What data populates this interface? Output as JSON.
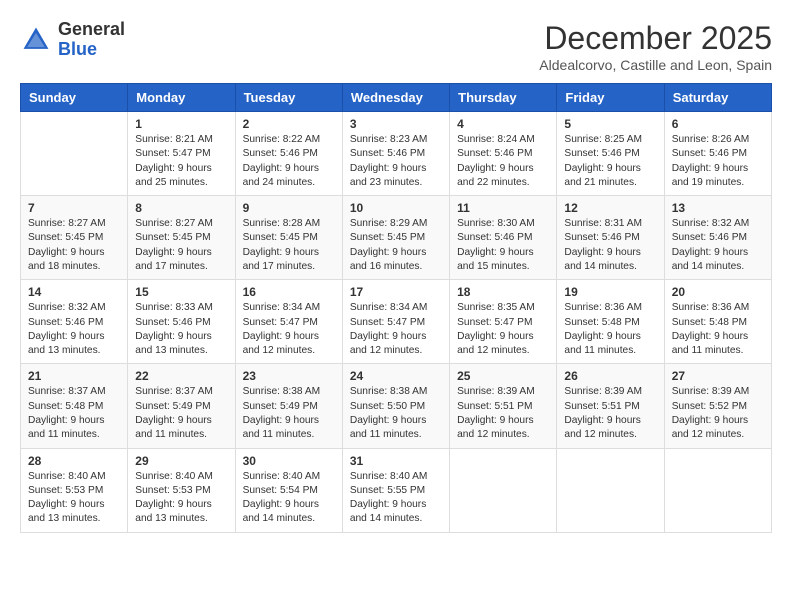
{
  "header": {
    "logo_general": "General",
    "logo_blue": "Blue",
    "month_title": "December 2025",
    "subtitle": "Aldealcorvo, Castille and Leon, Spain"
  },
  "calendar": {
    "days_of_week": [
      "Sunday",
      "Monday",
      "Tuesday",
      "Wednesday",
      "Thursday",
      "Friday",
      "Saturday"
    ],
    "weeks": [
      [
        {
          "day": "",
          "content": ""
        },
        {
          "day": "1",
          "content": "Sunrise: 8:21 AM\nSunset: 5:47 PM\nDaylight: 9 hours\nand 25 minutes."
        },
        {
          "day": "2",
          "content": "Sunrise: 8:22 AM\nSunset: 5:46 PM\nDaylight: 9 hours\nand 24 minutes."
        },
        {
          "day": "3",
          "content": "Sunrise: 8:23 AM\nSunset: 5:46 PM\nDaylight: 9 hours\nand 23 minutes."
        },
        {
          "day": "4",
          "content": "Sunrise: 8:24 AM\nSunset: 5:46 PM\nDaylight: 9 hours\nand 22 minutes."
        },
        {
          "day": "5",
          "content": "Sunrise: 8:25 AM\nSunset: 5:46 PM\nDaylight: 9 hours\nand 21 minutes."
        },
        {
          "day": "6",
          "content": "Sunrise: 8:26 AM\nSunset: 5:46 PM\nDaylight: 9 hours\nand 19 minutes."
        }
      ],
      [
        {
          "day": "7",
          "content": "Sunrise: 8:27 AM\nSunset: 5:45 PM\nDaylight: 9 hours\nand 18 minutes."
        },
        {
          "day": "8",
          "content": "Sunrise: 8:27 AM\nSunset: 5:45 PM\nDaylight: 9 hours\nand 17 minutes."
        },
        {
          "day": "9",
          "content": "Sunrise: 8:28 AM\nSunset: 5:45 PM\nDaylight: 9 hours\nand 17 minutes."
        },
        {
          "day": "10",
          "content": "Sunrise: 8:29 AM\nSunset: 5:45 PM\nDaylight: 9 hours\nand 16 minutes."
        },
        {
          "day": "11",
          "content": "Sunrise: 8:30 AM\nSunset: 5:46 PM\nDaylight: 9 hours\nand 15 minutes."
        },
        {
          "day": "12",
          "content": "Sunrise: 8:31 AM\nSunset: 5:46 PM\nDaylight: 9 hours\nand 14 minutes."
        },
        {
          "day": "13",
          "content": "Sunrise: 8:32 AM\nSunset: 5:46 PM\nDaylight: 9 hours\nand 14 minutes."
        }
      ],
      [
        {
          "day": "14",
          "content": "Sunrise: 8:32 AM\nSunset: 5:46 PM\nDaylight: 9 hours\nand 13 minutes."
        },
        {
          "day": "15",
          "content": "Sunrise: 8:33 AM\nSunset: 5:46 PM\nDaylight: 9 hours\nand 13 minutes."
        },
        {
          "day": "16",
          "content": "Sunrise: 8:34 AM\nSunset: 5:47 PM\nDaylight: 9 hours\nand 12 minutes."
        },
        {
          "day": "17",
          "content": "Sunrise: 8:34 AM\nSunset: 5:47 PM\nDaylight: 9 hours\nand 12 minutes."
        },
        {
          "day": "18",
          "content": "Sunrise: 8:35 AM\nSunset: 5:47 PM\nDaylight: 9 hours\nand 12 minutes."
        },
        {
          "day": "19",
          "content": "Sunrise: 8:36 AM\nSunset: 5:48 PM\nDaylight: 9 hours\nand 11 minutes."
        },
        {
          "day": "20",
          "content": "Sunrise: 8:36 AM\nSunset: 5:48 PM\nDaylight: 9 hours\nand 11 minutes."
        }
      ],
      [
        {
          "day": "21",
          "content": "Sunrise: 8:37 AM\nSunset: 5:48 PM\nDaylight: 9 hours\nand 11 minutes."
        },
        {
          "day": "22",
          "content": "Sunrise: 8:37 AM\nSunset: 5:49 PM\nDaylight: 9 hours\nand 11 minutes."
        },
        {
          "day": "23",
          "content": "Sunrise: 8:38 AM\nSunset: 5:49 PM\nDaylight: 9 hours\nand 11 minutes."
        },
        {
          "day": "24",
          "content": "Sunrise: 8:38 AM\nSunset: 5:50 PM\nDaylight: 9 hours\nand 11 minutes."
        },
        {
          "day": "25",
          "content": "Sunrise: 8:39 AM\nSunset: 5:51 PM\nDaylight: 9 hours\nand 12 minutes."
        },
        {
          "day": "26",
          "content": "Sunrise: 8:39 AM\nSunset: 5:51 PM\nDaylight: 9 hours\nand 12 minutes."
        },
        {
          "day": "27",
          "content": "Sunrise: 8:39 AM\nSunset: 5:52 PM\nDaylight: 9 hours\nand 12 minutes."
        }
      ],
      [
        {
          "day": "28",
          "content": "Sunrise: 8:40 AM\nSunset: 5:53 PM\nDaylight: 9 hours\nand 13 minutes."
        },
        {
          "day": "29",
          "content": "Sunrise: 8:40 AM\nSunset: 5:53 PM\nDaylight: 9 hours\nand 13 minutes."
        },
        {
          "day": "30",
          "content": "Sunrise: 8:40 AM\nSunset: 5:54 PM\nDaylight: 9 hours\nand 14 minutes."
        },
        {
          "day": "31",
          "content": "Sunrise: 8:40 AM\nSunset: 5:55 PM\nDaylight: 9 hours\nand 14 minutes."
        },
        {
          "day": "",
          "content": ""
        },
        {
          "day": "",
          "content": ""
        },
        {
          "day": "",
          "content": ""
        }
      ]
    ]
  }
}
